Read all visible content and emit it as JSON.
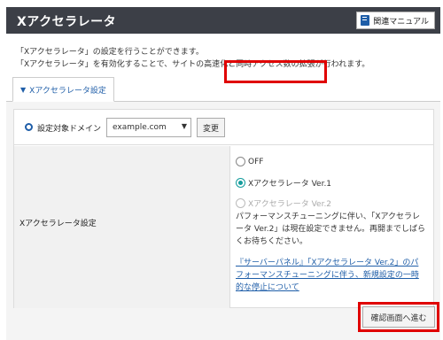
{
  "header": {
    "title": "Xアクセラレータ",
    "manual_label": "関連マニュアル"
  },
  "intro": {
    "line1": "「Xアクセラレータ」の設定を行うことができます。",
    "line2": "「Xアクセラレータ」を有効化することで、サイトの高速化と同時アクセス数の拡張が行われます。"
  },
  "tab": {
    "label": "Xアクセラレータ設定"
  },
  "domain": {
    "label": "設定対象ドメイン",
    "value": "example.com",
    "change_label": "変更"
  },
  "setting": {
    "label": "Xアクセラレータ設定",
    "options": [
      {
        "label": "OFF",
        "state": "unchecked"
      },
      {
        "label": "Xアクセラレータ Ver.1",
        "state": "checked"
      },
      {
        "label": "Xアクセラレータ Ver.2",
        "state": "disabled"
      }
    ],
    "note": "パフォーマンスチューニングに伴い、「Xアクセラレータ Ver.2」は現在設定できません。再開までしばらくお待ちください。",
    "link": "『サーバーパネル』「Xアクセラレータ Ver.2」のパフォーマンスチューニングに伴う、新規設定の一時的な停止について"
  },
  "confirm_label": "確認画面へ進む",
  "colors": {
    "header_bg": "#3c3f47",
    "accent": "#1f5ea8",
    "radio_checked": "#139c9c",
    "highlight": "#e00000"
  }
}
